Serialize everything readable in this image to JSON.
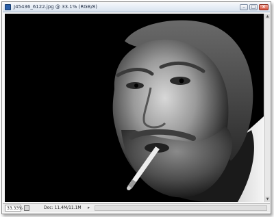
{
  "window": {
    "title": "J45436_6122.jpg @ 33.1% (RGB/8)",
    "icons": {
      "app": "photoshop-document-icon",
      "minimize": "minimize-icon",
      "maximize": "maximize-icon",
      "close": "close-icon"
    },
    "button_glyphs": {
      "minimize": "–",
      "maximize": "□",
      "close": "×"
    }
  },
  "canvas": {
    "content": "photo-black-and-white-portrait"
  },
  "status": {
    "zoom": "33.33%",
    "doc_info": "Doc: 11.4M/11.1M",
    "arrow": "▸"
  }
}
